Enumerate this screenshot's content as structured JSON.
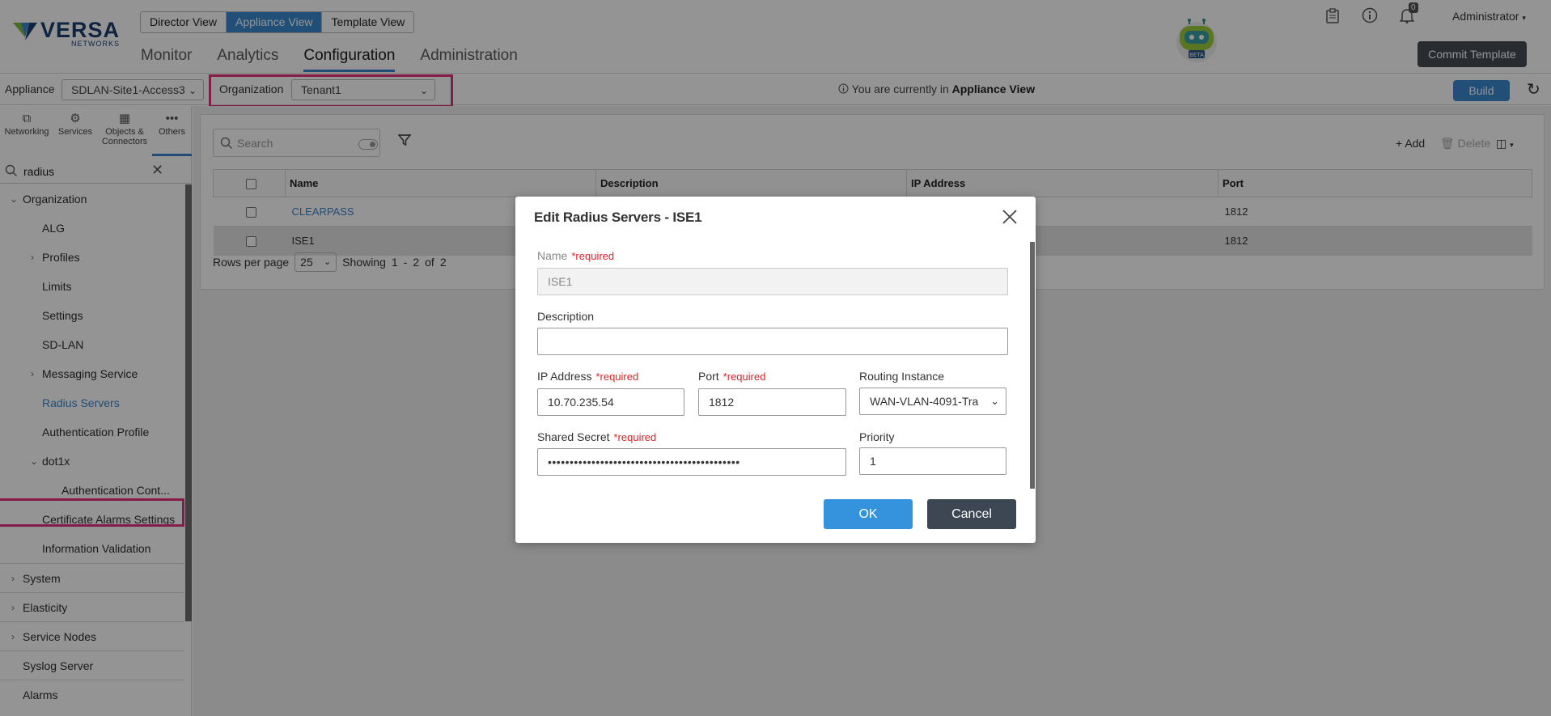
{
  "header": {
    "logo": {
      "main": "VERSA",
      "sub": "NETWORKS"
    },
    "view_switch": [
      "Director View",
      "Appliance View",
      "Template View"
    ],
    "active_view": "Appliance View",
    "tabs": [
      "Monitor",
      "Analytics",
      "Configuration",
      "Administration"
    ],
    "active_tab": "Configuration",
    "robot_badge": "BETA",
    "notifications_count": "0",
    "user": "Administrator",
    "commit_button": "Commit Template"
  },
  "toolbar": {
    "appliance_label": "Appliance",
    "appliance_value": "SDLAN-Site1-Access3",
    "organization_label": "Organization",
    "organization_value": "Tenant1",
    "view_info_prefix": "You are currently in",
    "view_info_strong": "Appliance View",
    "build_button": "Build"
  },
  "sidebar": {
    "icons": [
      "Networking",
      "Services",
      "Objects & Connectors",
      "Others"
    ],
    "active_icon": "Others",
    "search_value": "radius",
    "tree": [
      {
        "label": "Organization"
      },
      {
        "label": "ALG"
      },
      {
        "label": "Profiles"
      },
      {
        "label": "Limits"
      },
      {
        "label": "Settings"
      },
      {
        "label": "SD-LAN"
      },
      {
        "label": "Messaging Service"
      },
      {
        "label": "Radius Servers"
      },
      {
        "label": "Authentication Profile"
      },
      {
        "label": "dot1x"
      },
      {
        "label": "Authentication Cont..."
      },
      {
        "label": "Certificate Alarms Settings"
      },
      {
        "label": "Information Validation"
      },
      {
        "label": "System"
      },
      {
        "label": "Elasticity"
      },
      {
        "label": "Service Nodes"
      },
      {
        "label": "Syslog Server"
      },
      {
        "label": "Alarms"
      }
    ]
  },
  "main": {
    "search_placeholder": "Search",
    "add_label": "Add",
    "delete_label": "Delete",
    "columns": [
      "Name",
      "Description",
      "IP Address",
      "Port"
    ],
    "rows": [
      {
        "name": "CLEARPASS",
        "description": "",
        "ip": "",
        "port": "1812"
      },
      {
        "name": "ISE1",
        "description": "",
        "ip": "",
        "port": "1812"
      }
    ],
    "pager": {
      "rows_per_page_label": "Rows per page",
      "rows_per_page": "25",
      "showing": "Showing",
      "from": "1",
      "dash": "-",
      "to": "2",
      "of": "of",
      "total": "2"
    }
  },
  "modal": {
    "title": "Edit Radius Servers - ISE1",
    "required_text": "*required",
    "name_label": "Name",
    "name_value": "ISE1",
    "description_label": "Description",
    "description_value": "",
    "ip_label": "IP Address",
    "ip_value": "10.70.235.54",
    "port_label": "Port",
    "port_value": "1812",
    "routing_label": "Routing Instance",
    "routing_value": "WAN-VLAN-4091-Tra",
    "secret_label": "Shared Secret",
    "secret_value": "••••••••••••••••••••••••••••••••••••••••••••",
    "priority_label": "Priority",
    "priority_value": "1",
    "ok": "OK",
    "cancel": "Cancel"
  },
  "colors": {
    "accent": "#3989cf",
    "highlight": "#e8307a",
    "required": "#d8232a",
    "dark_button": "#3d4754"
  }
}
